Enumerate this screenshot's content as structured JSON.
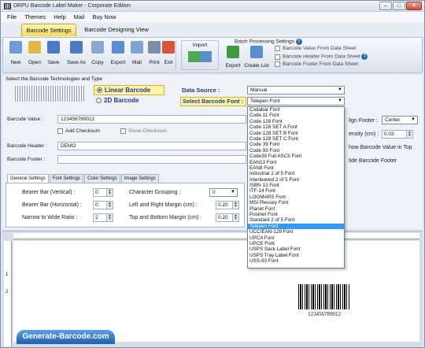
{
  "window": {
    "title": "DRPU Barcode Label Maker - Corporate Edition",
    "min": "–",
    "max": "□",
    "close": "✕"
  },
  "menu": [
    "File",
    "Themes",
    "Help",
    "Mail",
    "Buy Now"
  ],
  "tabs": {
    "settings": "Barcode Settings",
    "designing": "Barcode Designing View"
  },
  "toolbar": [
    {
      "label": "New",
      "color": "#6f9bd6"
    },
    {
      "label": "Open",
      "color": "#e2b845"
    },
    {
      "label": "Save",
      "color": "#4c79c4"
    },
    {
      "label": "Save As",
      "color": "#4c79c4"
    },
    {
      "label": "Copy",
      "color": "#8aa8d0"
    },
    {
      "label": "Export",
      "color": "#5a8ecf"
    },
    {
      "label": "Mail",
      "color": "#7fa4cf"
    },
    {
      "label": "Print",
      "color": "#7a8ea8"
    },
    {
      "label": "Exit",
      "color": "#d6563c"
    }
  ],
  "batch": {
    "title": "Batch Processing Settings",
    "import": "Import",
    "export": "Export",
    "create_list": "Create List",
    "opt1": "Barcode Value From Data Sheet",
    "opt2": "Barcode Header From Data Sheet",
    "opt3": "Barcode Footer From Data Sheet"
  },
  "panel": {
    "title": "Select the Barcode Technologies and Type",
    "linear": "Linear Barcode",
    "two_d": "2D Barcode",
    "data_source_label": "Data Source :",
    "data_source_value": "Manual",
    "font_label": "Select Barcode Font :",
    "font_value": "Telepen Font"
  },
  "fields": {
    "value_label": "Barcode Value :",
    "value": "123456789012",
    "add_checksum": "Add Checksum",
    "show_checksum": "Show Checksum",
    "header_label": "Barcode Header :",
    "header": "DEMO",
    "footer_label": "Barcode Footer :",
    "footer": ""
  },
  "right": {
    "align_footer_label": "lign Footer :",
    "align_footer_value": "Center",
    "density_label": "ensity (cm) :",
    "density_value": "0.03",
    "show_top": "how Barcode Value in Top",
    "hide_footer": "lide Barcode Footer"
  },
  "subtabs": [
    "General Settings",
    "Font Settings",
    "Color Settings",
    "Image Settings"
  ],
  "general": {
    "bearer_v_label": "Bearer Bar (Vertical) :",
    "bearer_v": "0",
    "bearer_h_label": "Bearer Bar (Horizontal) :",
    "bearer_h": "0",
    "ratio_label": "Narrow to Wide Ratio :",
    "ratio": "2",
    "grouping_label": "Character Grouping :",
    "grouping": "0",
    "lr_label": "Left and Right Margin (cm) :",
    "lr": "0.20",
    "tb_label": "Top and Bottom Margin (cm) :",
    "tb": "0.20"
  },
  "font_list": [
    "Codabar Font",
    "Code 11 Font",
    "Code 128 Font",
    "Code 128 SET A Font",
    "Code 128 SET B Font",
    "Code 128 SET C Font",
    "Code 39 Font",
    "Code 93 Font",
    "Code39 Full ASCII Font",
    "EAN13 Font",
    "EAN8 Font",
    "Industrial 2 of 5 Font",
    "Interleaved 2 of 5 Font",
    "ISBN 13 Font",
    "ITF-14 Font",
    "LOGMARS Font",
    "MSI Plessey Font",
    "Planet Font",
    "Postnet Font",
    "Standard 2 of 5 Font",
    "Telepen Font",
    "UCC/EAN-128 Font",
    "UPCA Font",
    "UPCE Font",
    "USPS Sack Label Font",
    "USPS Tray Label Font",
    "USS-93 Font"
  ],
  "selected_font_index": 20,
  "canvas": {
    "barcode_text": "123456789012",
    "ruler_1": "1",
    "ruler_2": "2"
  },
  "footer_brand": "Generate-Barcode.com"
}
